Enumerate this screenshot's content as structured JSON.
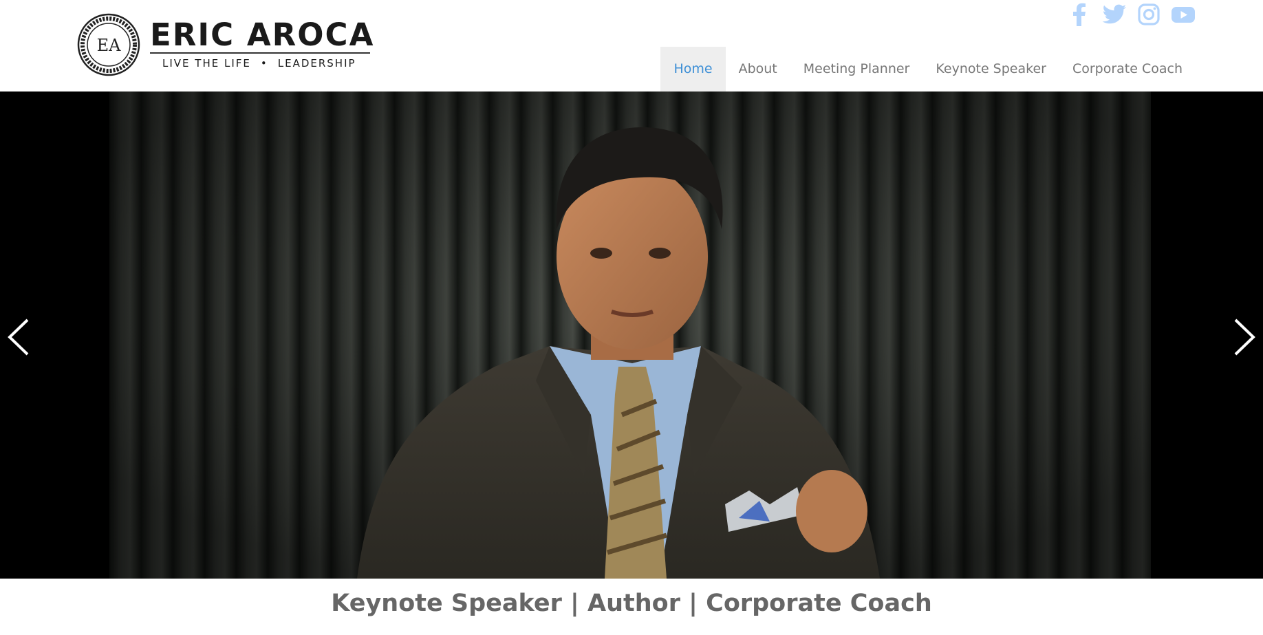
{
  "brand": {
    "monogram": "EA",
    "name": "ERIC AROCA",
    "tagline_left": "LIVE THE LIFE",
    "tagline_sep": "•",
    "tagline_right": "LEADERSHIP"
  },
  "social": [
    {
      "icon": "facebook-icon"
    },
    {
      "icon": "twitter-icon"
    },
    {
      "icon": "instagram-icon"
    },
    {
      "icon": "youtube-icon"
    }
  ],
  "social_color": "#b3d4fc",
  "nav": {
    "items": [
      {
        "label": "Home",
        "active": true
      },
      {
        "label": "About",
        "active": false
      },
      {
        "label": "Meeting Planner",
        "active": false
      },
      {
        "label": "Keynote Speaker",
        "active": false
      },
      {
        "label": "Corporate Coach",
        "active": false
      }
    ],
    "active_color": "#3d8fd6",
    "text_color": "#777777"
  },
  "hero": {
    "prev_icon": "chevron-left-icon",
    "next_icon": "chevron-right-icon"
  },
  "caption": "Keynote Speaker | Author | Corporate Coach"
}
